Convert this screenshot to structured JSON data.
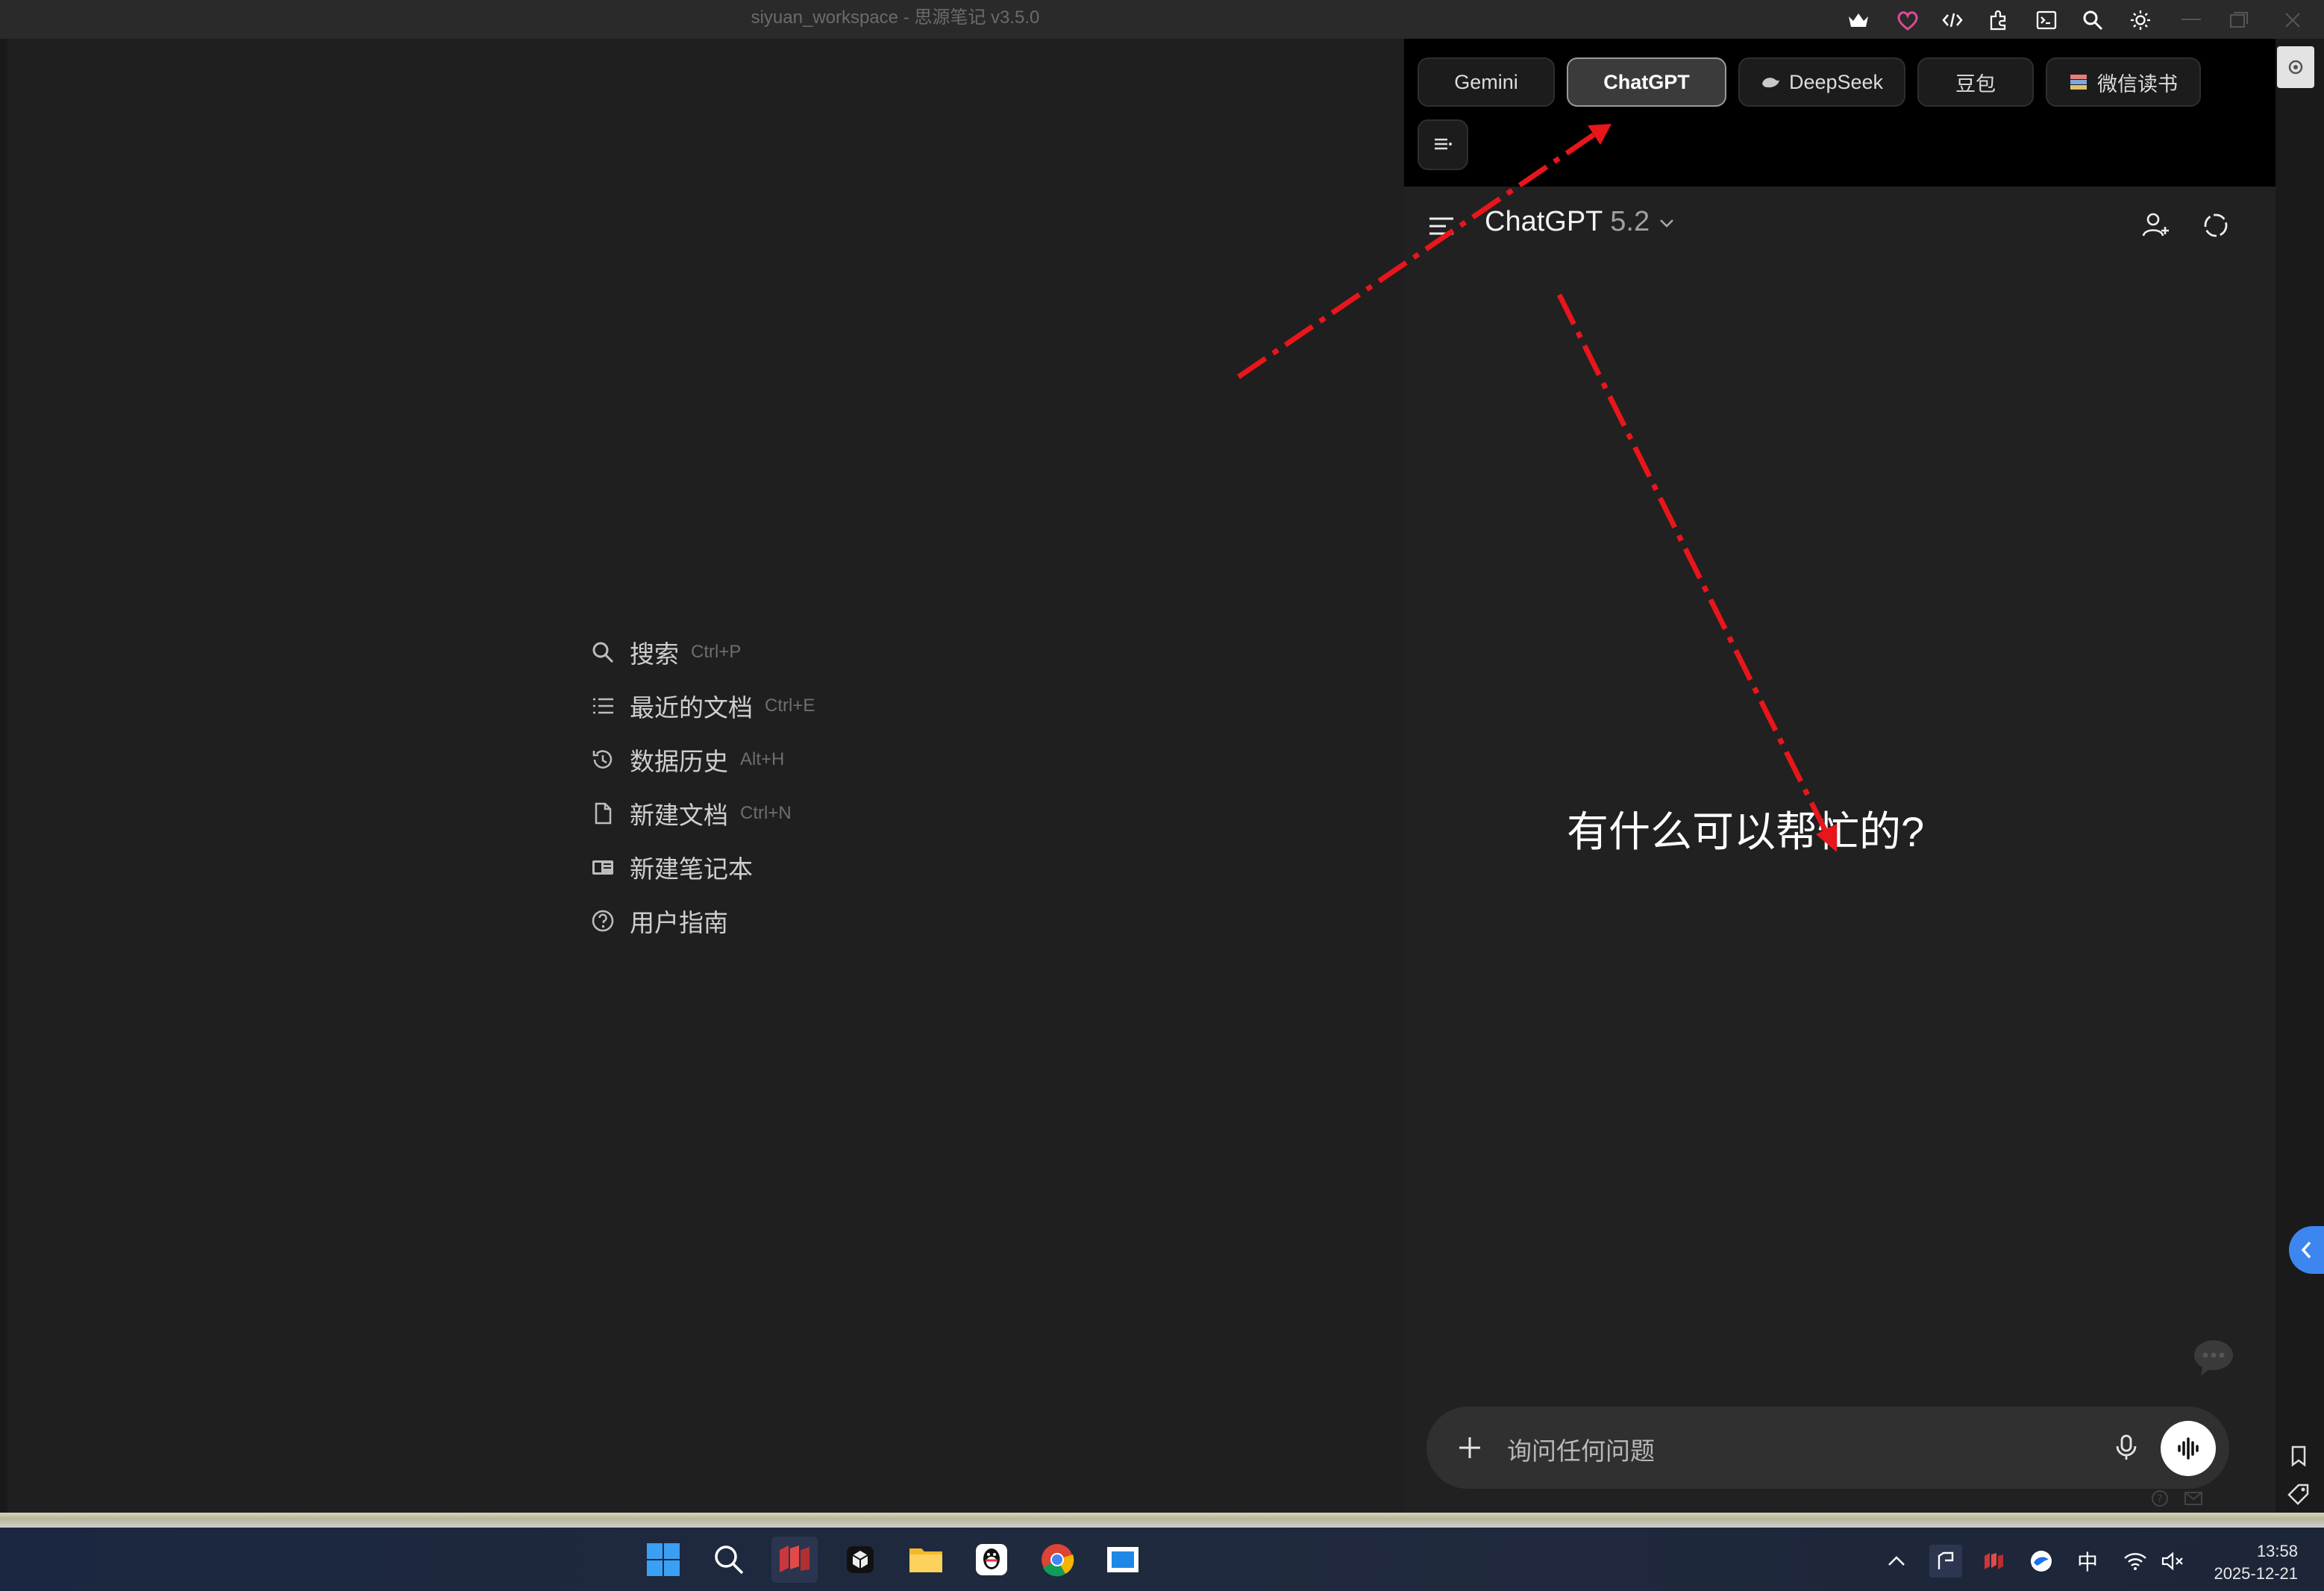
{
  "window": {
    "title": "siyuan_workspace - 思源笔记 v3.5.0"
  },
  "left_menu": {
    "items": [
      {
        "label": "搜索",
        "shortcut": "Ctrl+P",
        "icon": "search-icon"
      },
      {
        "label": "最近的文档",
        "shortcut": "Ctrl+E",
        "icon": "list-icon"
      },
      {
        "label": "数据历史",
        "shortcut": "Alt+H",
        "icon": "history-icon"
      },
      {
        "label": "新建文档",
        "shortcut": "Ctrl+N",
        "icon": "new-document-icon"
      },
      {
        "label": "新建笔记本",
        "shortcut": "",
        "icon": "notebook-icon"
      },
      {
        "label": "用户指南",
        "shortcut": "",
        "icon": "help-circle-icon"
      }
    ]
  },
  "tabs": [
    {
      "label": "Gemini",
      "active": false
    },
    {
      "label": "ChatGPT",
      "active": true
    },
    {
      "label": "DeepSeek",
      "active": false
    },
    {
      "label": "豆包",
      "active": false
    },
    {
      "label": "微信读书",
      "active": false
    }
  ],
  "chatgpt": {
    "model_name": "ChatGPT",
    "model_version": "5.2",
    "greeting": "有什么可以帮忙的?",
    "input_placeholder": "询问任何问题"
  },
  "taskbar": {
    "time": "13:58",
    "date": "2025-12-21",
    "ime": "中"
  },
  "colors": {
    "annotation_arrow": "#e8161b",
    "accent_blue": "#3d86f0"
  }
}
